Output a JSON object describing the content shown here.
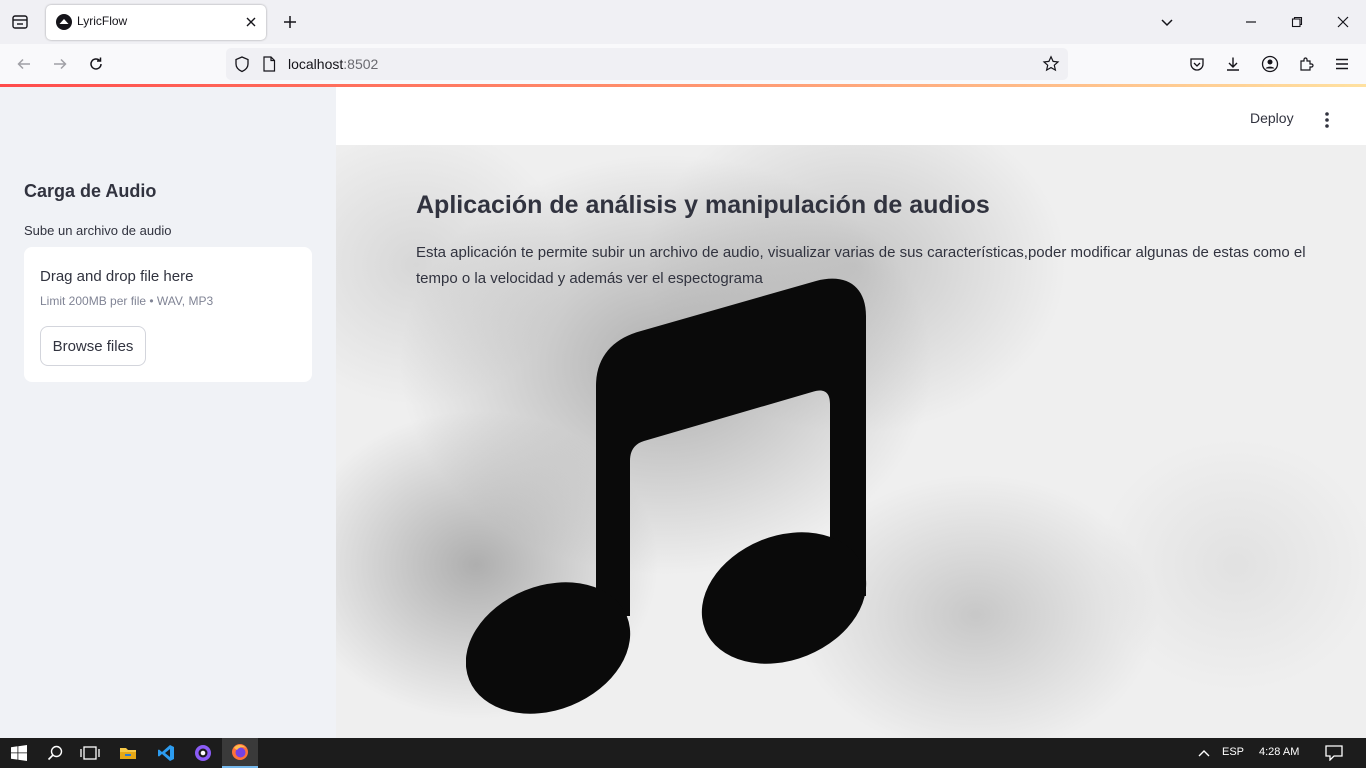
{
  "browser": {
    "tab_title": "LyricFlow",
    "url_host": "localhost",
    "url_port": ":8502"
  },
  "app_header": {
    "deploy_label": "Deploy"
  },
  "sidebar": {
    "title": "Carga de Audio",
    "uploader_label": "Sube un archivo de audio",
    "dropzone_title": "Drag and drop file here",
    "dropzone_limit": "Limit 200MB per file • WAV, MP3",
    "browse_label": "Browse files"
  },
  "main": {
    "title": "Aplicación de análisis y manipulación de audios",
    "description": "Esta aplicación te permite subir un archivo de audio, visualizar varias de sus características,poder modificar algunas de estas como el tempo o la velocidad y además ver el espectograma"
  },
  "taskbar": {
    "language": "ESP",
    "time": "4:28 AM"
  },
  "colors": {
    "accent": "#ff4b4b",
    "sidebar_bg": "#f0f2f6",
    "text": "#31333f"
  },
  "icons": [
    "tab-list-icon",
    "favicon-icon",
    "close-icon",
    "plus-icon",
    "chevron-down-icon",
    "minimize-icon",
    "restore-icon",
    "back-icon",
    "forward-icon",
    "reload-icon",
    "shield-icon",
    "page-icon",
    "star-icon",
    "pocket-icon",
    "download-icon",
    "account-icon",
    "extensions-icon",
    "menu-icon",
    "kebab-icon",
    "music-note-icon",
    "windows-start-icon",
    "search-icon",
    "task-view-icon",
    "folder-icon",
    "vscode-icon",
    "github-icon",
    "firefox-icon",
    "chevron-up-icon",
    "notification-icon"
  ]
}
